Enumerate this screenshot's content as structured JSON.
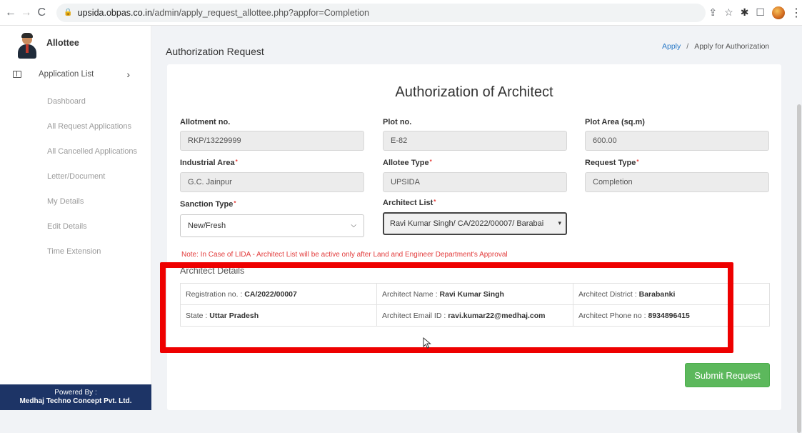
{
  "browser": {
    "url_host": "upsida.obpas.co.in",
    "url_path": "/admin/apply_request_allottee.php?appfor=Completion"
  },
  "sidebar": {
    "user_name": "Allottee",
    "menu_header": "Application List",
    "items": [
      {
        "label": "Dashboard"
      },
      {
        "label": "All Request Applications"
      },
      {
        "label": "All Cancelled Applications"
      },
      {
        "label": "Letter/Document"
      },
      {
        "label": "My Details"
      },
      {
        "label": "Edit Details"
      },
      {
        "label": "Time Extension"
      }
    ],
    "powered_label": "Powered By :",
    "powered_company": "Medhaj Techno Concept Pvt. Ltd."
  },
  "page": {
    "title": "Authorization Request",
    "breadcrumb": {
      "link": "Apply",
      "separator": "/",
      "current": "Apply for Authorization"
    }
  },
  "form": {
    "heading": "Authorization of Architect",
    "allotment_no": {
      "label": "Allotment no.",
      "value": "RKP/13229999"
    },
    "plot_no": {
      "label": "Plot no.",
      "value": "E-82"
    },
    "plot_area": {
      "label": "Plot Area (sq.m)",
      "value": "600.00"
    },
    "industrial_area": {
      "label": "Industrial Area",
      "value": "G.C. Jainpur"
    },
    "allotee_type": {
      "label": "Allotee Type",
      "value": "UPSIDA"
    },
    "request_type": {
      "label": "Request Type",
      "value": "Completion"
    },
    "sanction_type": {
      "label": "Sanction Type",
      "value": "New/Fresh"
    },
    "architect_list": {
      "label": "Architect List",
      "value": "Ravi Kumar Singh/ CA/2022/00007/ Barabai"
    },
    "required_mark": "*",
    "note": "Note: In Case of LIDA - Architect List will be active only after Land and Engineer Department's Approval"
  },
  "architect_details": {
    "title": "Architect Details",
    "registration": {
      "label": "Registration no. : ",
      "value": "CA/2022/00007"
    },
    "name": {
      "label": "Architect Name : ",
      "value": "Ravi Kumar Singh"
    },
    "district": {
      "label": "Architect District : ",
      "value": "Barabanki"
    },
    "state": {
      "label": "State : ",
      "value": "Uttar Pradesh"
    },
    "email": {
      "label": "Architect Email ID : ",
      "value": "ravi.kumar22@medhaj.com"
    },
    "phone": {
      "label": "Architect Phone no : ",
      "value": "8934896415"
    }
  },
  "submit_label": "Submit Request",
  "colors": {
    "submit": "#5cb85c",
    "highlight": "#ee0000",
    "note": "#e23b3b",
    "footer": "#1d3466"
  }
}
